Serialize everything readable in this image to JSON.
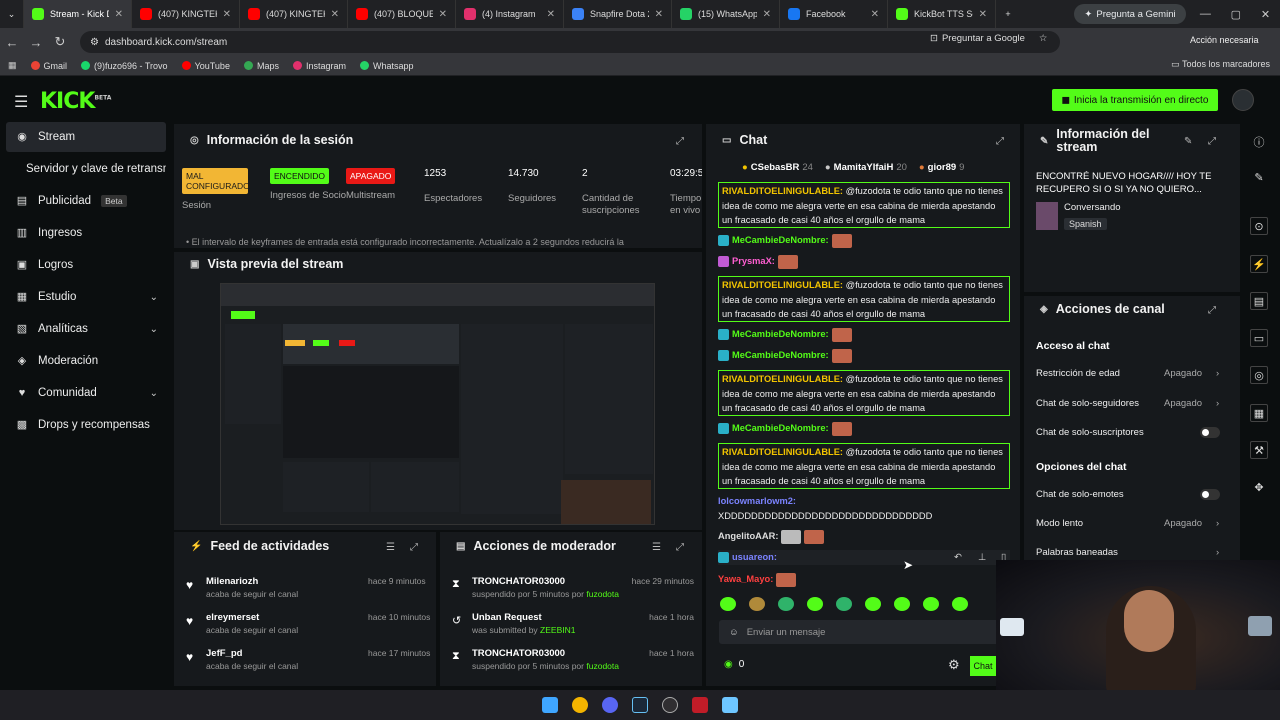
{
  "browser": {
    "tabs": [
      {
        "label": "Stream - Kick Da",
        "fav": "#53fc18",
        "active": true
      },
      {
        "label": "(407) KINGTEKA",
        "fav": "#ff0000"
      },
      {
        "label": "(407) KINGTEKA Y",
        "fav": "#ff0000"
      },
      {
        "label": "(407) BLOQUEAN",
        "fav": "#ff0000"
      },
      {
        "label": "(4) Instagram",
        "fav": "#e1306c"
      },
      {
        "label": "Snapfire Dota 2 T",
        "fav": "#3b82f6"
      },
      {
        "label": "(15) WhatsApp",
        "fav": "#25d366"
      },
      {
        "label": "Facebook",
        "fav": "#1877f2"
      },
      {
        "label": "KickBot TTS Setti",
        "fav": "#53fc18"
      }
    ],
    "gemini": "Pregunta a Gemini",
    "url": "dashboard.kick.com/stream",
    "ask_google": "Preguntar a Google",
    "action_needed": "Acción necesaria",
    "bookmarks": [
      {
        "label": "Gmail",
        "color": "#ea4335"
      },
      {
        "label": "(9)fuzo696 - Trovo",
        "color": "#19d66b"
      },
      {
        "label": "YouTube",
        "color": "#ff0000"
      },
      {
        "label": "Maps",
        "color": "#34a853"
      },
      {
        "label": "Instagram",
        "color": "#e1306c"
      },
      {
        "label": "Whatsapp",
        "color": "#25d366"
      }
    ],
    "all_bookmarks": "Todos los marcadores"
  },
  "header": {
    "logo": "KICK",
    "logo_sup": "BETA",
    "go_live": "Inicia la transmisión en directo"
  },
  "sidebar": {
    "items": [
      {
        "label": "Stream",
        "icon": "broadcast-icon",
        "glyph": "◉"
      },
      {
        "label": "Servidor y clave de retransmisión",
        "icon": "",
        "glyph": ""
      },
      {
        "label": "Publicidad",
        "icon": "ads-icon",
        "glyph": "▤",
        "badge": "Beta"
      },
      {
        "label": "Ingresos",
        "icon": "revenue-icon",
        "glyph": "▥"
      },
      {
        "label": "Logros",
        "icon": "achievements-icon",
        "glyph": "▣"
      },
      {
        "label": "Estudio",
        "icon": "studio-icon",
        "glyph": "▦"
      },
      {
        "label": "Analíticas",
        "icon": "analytics-icon",
        "glyph": "▧"
      },
      {
        "label": "Moderación",
        "icon": "moderation-icon",
        "glyph": "◈"
      },
      {
        "label": "Comunidad",
        "icon": "community-icon",
        "glyph": "♥"
      },
      {
        "label": "Drops y recompensas",
        "icon": "drops-icon",
        "glyph": "▩"
      }
    ]
  },
  "session": {
    "title": "Información de la sesión",
    "stats": [
      {
        "value": "MAL CONFIGURADO",
        "label": "Sesión",
        "kind": "yellow"
      },
      {
        "value": "ENCENDIDO",
        "label": "Ingresos de Socio",
        "kind": "green"
      },
      {
        "value": "APAGADO",
        "label": "Multistream",
        "kind": "red"
      },
      {
        "value": "1253",
        "label": "Espectadores"
      },
      {
        "value": "14.730",
        "label": "Seguidores"
      },
      {
        "value": "2",
        "label": "Cantidad de suscripciones"
      },
      {
        "value": "03:29:5",
        "label": "Tiempo en vivo"
      }
    ],
    "warning": "El intervalo de keyframes de entrada está configurado incorrectamente. Actualízalo a 2 segundos reducirá la"
  },
  "preview": {
    "title": "Vista previa del stream"
  },
  "activity": {
    "title": "Feed de actividades",
    "items": [
      {
        "name": "Milenariozh",
        "sub": "acaba de seguir el canal",
        "time": "hace 9 minutos"
      },
      {
        "name": "elreymerset",
        "sub": "acaba de seguir el canal",
        "time": "hace 10 minutos"
      },
      {
        "name": "JefF_pd",
        "sub": "acaba de seguir el canal",
        "time": "hace 17 minutos"
      }
    ]
  },
  "mod_actions": {
    "title": "Acciones de moderador",
    "items": [
      {
        "name": "TRONCHATOR03000",
        "sub": "suspendido por 5 minutos por",
        "by": "fuzodota",
        "time": "hace 29 minutos",
        "glyph": "⧗"
      },
      {
        "name": "Unban Request",
        "sub": "was submitted by",
        "by": "ZEEBIN1",
        "time": "hace 1 hora",
        "glyph": "↺"
      },
      {
        "name": "TRONCHATOR03000",
        "sub": "suspendido por 5 minutos por",
        "by": "fuzodota",
        "time": "hace 1 hora",
        "glyph": "⧗"
      }
    ]
  },
  "chat": {
    "title": "Chat",
    "top_users": [
      {
        "name": "CSebasBR",
        "count": "24",
        "color": "#f2c400"
      },
      {
        "name": "MamitaYIfaiH",
        "count": "20",
        "color": "#c8c8c8"
      },
      {
        "name": "gior89",
        "count": "9",
        "color": "#e07b39"
      }
    ],
    "spam_text": "@fuzodota te odio tanto que no tienes idea de como me alegra verte en esa cabina de mierda apestando un fracasado de casi 40 años el orgullo de mama",
    "spam_user": "RIVALDITOELINIGULABLE:",
    "mecambie": "MeCambieDeNombre:",
    "prysmax": "PrysmaX:",
    "lolcow_user": "lolcowmarlowm2:",
    "lolcow_text": "XDDDDDDDDDDDDDDDDDDDDDDDDDDDDDDD",
    "angelito": "AngelitoAAR:",
    "usuareon": "usuareon:",
    "yawa": "Yawa_Mayo:",
    "input_placeholder": "Enviar un mensaje",
    "points": "0",
    "send": "Chat"
  },
  "stream_info": {
    "title": "Información del stream",
    "stream_title": "ENCONTRÉ NUEVO HOGAR//// HOY TE RECUPERO SI O SI YA NO QUIERO...",
    "category": "Conversando",
    "language": "Spanish"
  },
  "channel_actions": {
    "title": "Acciones de canal",
    "chat_access": "Acceso al chat",
    "age": {
      "label": "Restricción de edad",
      "value": "Apagado"
    },
    "followers": {
      "label": "Chat de solo-seguidores",
      "value": "Apagado"
    },
    "subs": {
      "label": "Chat de solo-suscriptores"
    },
    "chat_options": "Opciones del chat",
    "emotes": {
      "label": "Chat de solo-emotes"
    },
    "slow": {
      "label": "Modo lento",
      "value": "Apagado"
    },
    "banned": {
      "label": "Palabras baneadas"
    }
  }
}
